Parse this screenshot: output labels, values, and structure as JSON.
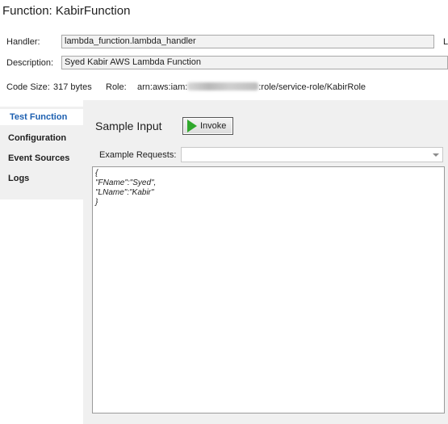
{
  "page": {
    "title": "Function: KabirFunction"
  },
  "handler": {
    "label": "Handler:",
    "value": "lambda_function.lambda_handler",
    "cut_label": "L"
  },
  "description": {
    "label": "Description:",
    "value": "Syed Kabir AWS Lambda Function"
  },
  "info": {
    "code_size_label": "Code Size:",
    "code_size_value": "317 bytes",
    "role_label": "Role:",
    "role_prefix": "arn:aws:iam:",
    "role_suffix": ":role/service-role/KabirRole"
  },
  "sidebar": {
    "items": [
      {
        "label": "Test Function",
        "active": true
      },
      {
        "label": "Configuration",
        "active": false
      },
      {
        "label": "Event Sources",
        "active": false
      },
      {
        "label": "Logs",
        "active": false
      }
    ]
  },
  "main": {
    "sample_input_title": "Sample Input",
    "invoke_label": "Invoke",
    "example_requests_label": "Example Requests:",
    "example_requests_value": "",
    "code_lines": [
      "{",
      "\"FName\":\"Syed\",",
      "\"LName\":\"Kabir\"",
      "}"
    ]
  },
  "colors": {
    "active_tab_text": "#1c5fb0",
    "play_icon": "#2fa82b"
  },
  "icons": {
    "invoke": "play-icon",
    "dropdown": "chevron-down-icon"
  }
}
